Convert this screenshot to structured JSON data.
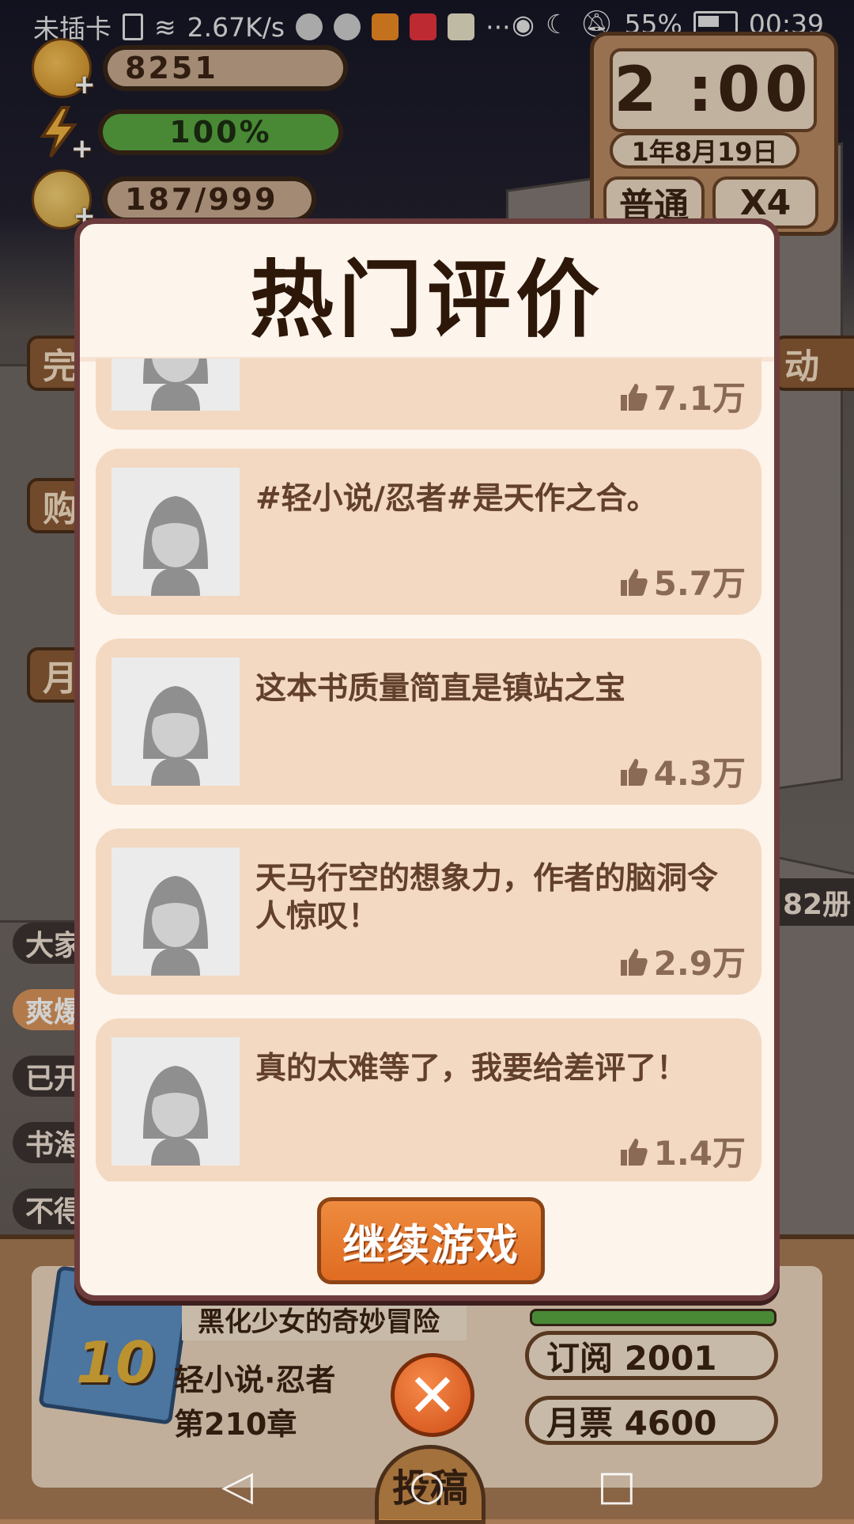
{
  "status_bar": {
    "carrier": "未插卡",
    "speed": "2.67K/s",
    "battery": "55%",
    "time": "00:39",
    "icons": [
      "sim-icon",
      "wifi-icon",
      "qq-icon",
      "wechat-icon",
      "uc-icon",
      "huawei-store-icon",
      "cat-app-icon",
      "more-icon",
      "eye-icon",
      "moon-icon",
      "mute-icon",
      "battery-icon"
    ]
  },
  "hud": {
    "coins": "8251",
    "energy": "100%",
    "energy_fraction": 1.0,
    "ideas": "187/999",
    "clock": "2 :00",
    "date": "1年8月19日",
    "mode_label": "普通",
    "speed_label": "X4"
  },
  "side": {
    "left_buttons": [
      "完",
      "购",
      "月"
    ],
    "right_buttons": [
      "动"
    ],
    "chips": [
      "大家",
      "爽爆",
      "已开",
      "书海",
      "不得"
    ],
    "books_count": "82册"
  },
  "modal": {
    "title": "热门评价",
    "reviews": [
      {
        "text": "",
        "likes": "7.1万"
      },
      {
        "text": "#轻小说/忍者#是天作之合。",
        "likes": "5.7万"
      },
      {
        "text": "这本书质量简直是镇站之宝",
        "likes": "4.3万"
      },
      {
        "text": "天马行空的想象力，作者的脑洞令人惊叹！",
        "likes": "2.9万"
      },
      {
        "text": "真的太难等了，我要给差评了！",
        "likes": "1.4万"
      }
    ],
    "continue_label": "继续游戏"
  },
  "bottom": {
    "book_title": "黑化少女的奇妙冒险",
    "book_number": "10",
    "genre": "轻小说·忍者",
    "chapter": "第210章",
    "subscriptions": "订阅 2001",
    "monthly_votes": "月票 4600",
    "close_symbol": "✕",
    "submit_label": "投稿"
  },
  "navbar": {
    "back": "◁",
    "home": "○",
    "recent": "□"
  },
  "colors": {
    "modal_bg": "#fdf4ec",
    "card_bg": "#f3d9c1",
    "accent_orange": "#e6782f",
    "title_text": "#2c1708",
    "review_text": "#62402c"
  }
}
